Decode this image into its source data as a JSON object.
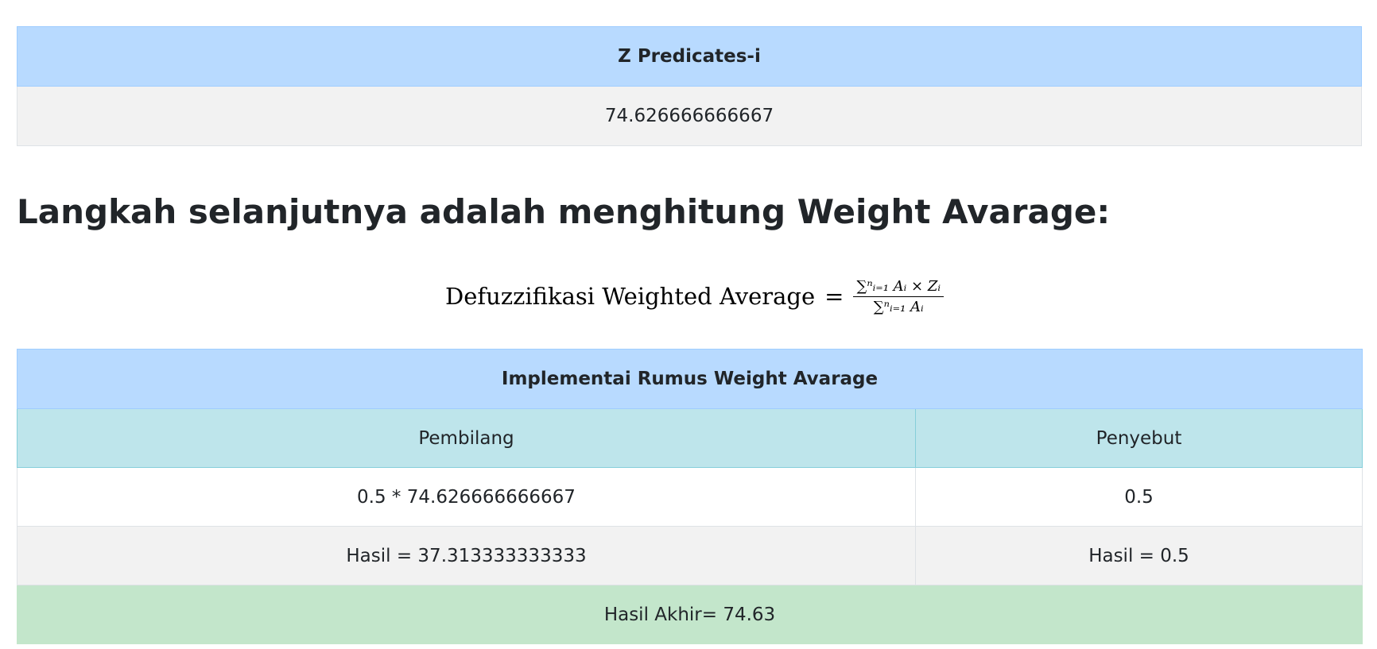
{
  "z_table": {
    "header": "Z Predicates-i",
    "value": "74.626666666667"
  },
  "heading": "Langkah selanjutnya adalah menghitung Weight Avarage:",
  "formula": {
    "lhs": "Defuzzifikasi Weighted Average",
    "eq": "=",
    "numerator": "∑ⁿᵢ₌₁ Aᵢ × Zᵢ",
    "denominator": "∑ⁿᵢ₌₁ Aᵢ"
  },
  "impl_table": {
    "header": "Implementai Rumus Weight Avarage",
    "columns": [
      "Pembilang",
      "Penyebut"
    ],
    "rows": [
      [
        "0.5 * 74.626666666667",
        "0.5"
      ],
      [
        "Hasil = 37.313333333333",
        "Hasil = 0.5"
      ]
    ],
    "final": "Hasil Akhir= 74.63"
  }
}
